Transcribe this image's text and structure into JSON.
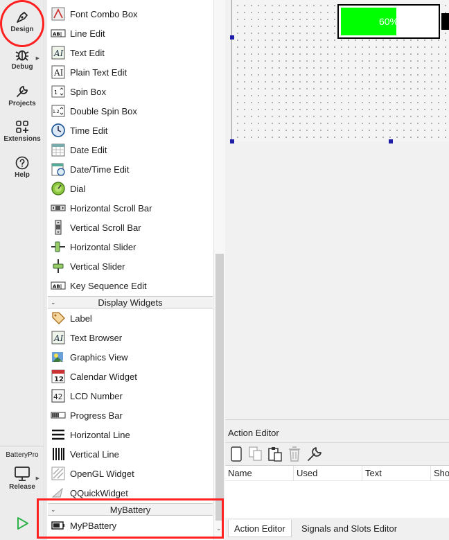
{
  "modes": [
    {
      "label": "Design",
      "icon": "pen-nib-icon"
    },
    {
      "label": "Debug",
      "icon": "bug-icon"
    },
    {
      "label": "Projects",
      "icon": "wrench-icon"
    },
    {
      "label": "Extensions",
      "icon": "extensions-grid-icon"
    },
    {
      "label": "Help",
      "icon": "help-icon"
    }
  ],
  "kit": {
    "project": "BatteryPro",
    "build": "Release",
    "icon": "monitor-icon"
  },
  "run": {
    "icon": "run-triangle-icon"
  },
  "widgets": {
    "input_items": [
      {
        "label": "Font Combo Box",
        "icon": "font-combo-box-icon"
      },
      {
        "label": "Line Edit",
        "icon": "line-edit-icon"
      },
      {
        "label": "Text Edit",
        "icon": "text-edit-icon"
      },
      {
        "label": "Plain Text Edit",
        "icon": "plain-text-edit-icon"
      },
      {
        "label": "Spin Box",
        "icon": "spin-box-icon"
      },
      {
        "label": "Double Spin Box",
        "icon": "double-spin-box-icon"
      },
      {
        "label": "Time Edit",
        "icon": "clock-icon"
      },
      {
        "label": "Date Edit",
        "icon": "calendar-grid-icon"
      },
      {
        "label": "Date/Time Edit",
        "icon": "calendar-clock-icon"
      },
      {
        "label": "Dial",
        "icon": "dial-icon"
      },
      {
        "label": "Horizontal Scroll Bar",
        "icon": "horizontal-scroll-bar-icon"
      },
      {
        "label": "Vertical Scroll Bar",
        "icon": "vertical-scroll-bar-icon"
      },
      {
        "label": "Horizontal Slider",
        "icon": "horizontal-slider-icon"
      },
      {
        "label": "Vertical Slider",
        "icon": "vertical-slider-icon"
      },
      {
        "label": "Key Sequence Edit",
        "icon": "key-sequence-edit-icon"
      }
    ],
    "display_category": "Display Widgets",
    "display_items": [
      {
        "label": "Label",
        "icon": "label-tag-icon"
      },
      {
        "label": "Text Browser",
        "icon": "text-browser-icon"
      },
      {
        "label": "Graphics View",
        "icon": "graphics-view-icon"
      },
      {
        "label": "Calendar Widget",
        "icon": "calendar-widget-icon"
      },
      {
        "label": "LCD Number",
        "icon": "lcd-number-icon"
      },
      {
        "label": "Progress Bar",
        "icon": "progress-bar-icon"
      },
      {
        "label": "Horizontal Line",
        "icon": "horizontal-line-icon"
      },
      {
        "label": "Vertical Line",
        "icon": "vertical-line-icon"
      },
      {
        "label": "OpenGL Widget",
        "icon": "opengl-widget-icon"
      },
      {
        "label": "QQuickWidget",
        "icon": "qquickwidget-icon"
      }
    ],
    "custom_category": "MyBattery",
    "custom_items": [
      {
        "label": "MyPBattery",
        "icon": "battery-icon"
      }
    ]
  },
  "form": {
    "battery": {
      "text": "60%",
      "level": 0.6,
      "fill_color": "#00ff00",
      "text_color": "#ffffff"
    }
  },
  "action_editor": {
    "title": "Action Editor",
    "toolbar": [
      "new-action-icon",
      "copy-icon",
      "paste-icon",
      "delete-icon",
      "configure-icon"
    ],
    "columns": [
      "Name",
      "Used",
      "Text",
      "Shortcut"
    ],
    "tabs": [
      "Action Editor",
      "Signals and Slots Editor"
    ],
    "active_tab": 0
  },
  "colors": {
    "annotation": "#ff2020",
    "selection_handle": "#1d1da8",
    "run_green": "#2fb24a"
  }
}
